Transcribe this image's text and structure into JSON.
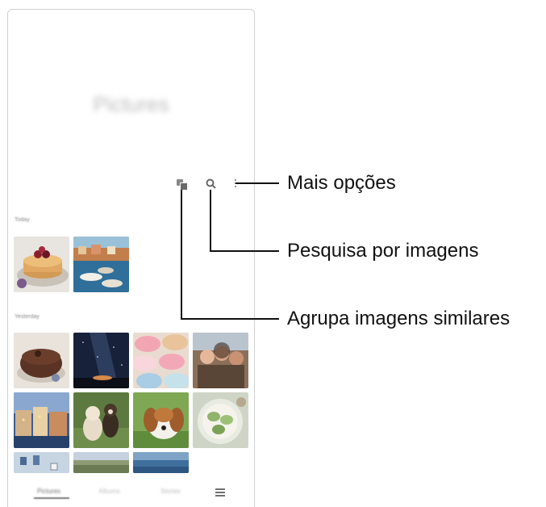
{
  "app": {
    "title": "Pictures"
  },
  "sections": [
    {
      "label": "Today"
    },
    {
      "label": "Yesterday"
    }
  ],
  "toolbar": {
    "icons": [
      "similar-images-icon",
      "search-icon",
      "more-options-icon"
    ]
  },
  "bottom_nav": {
    "tabs": [
      {
        "label": "Pictures"
      },
      {
        "label": "Albums"
      },
      {
        "label": "Stories"
      }
    ],
    "menu_icon": "menu-icon"
  },
  "callouts": {
    "more_options": "Mais opções",
    "search_images": "Pesquisa por imagens",
    "group_similar": "Agrupa imagens similares"
  }
}
